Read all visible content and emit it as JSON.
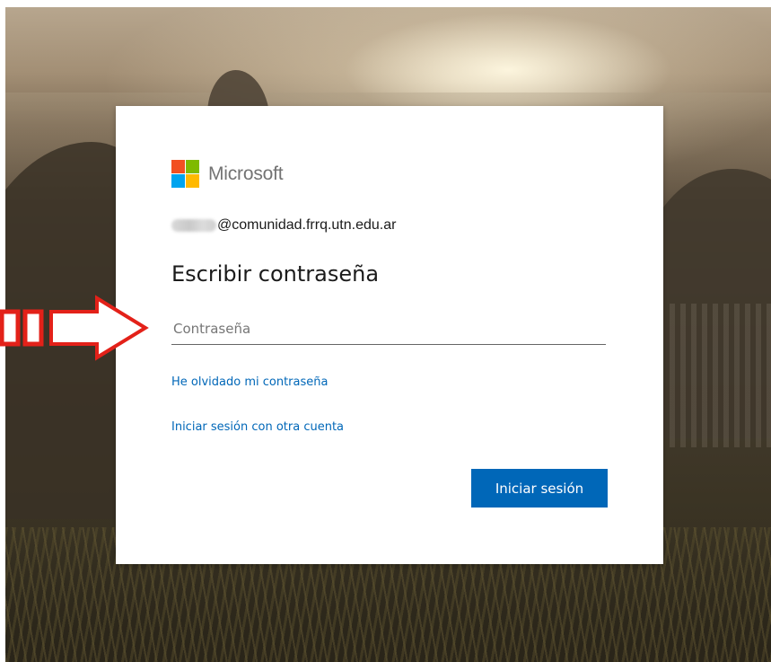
{
  "brand": {
    "name": "Microsoft",
    "logo_colors": [
      "#f25022",
      "#7fba00",
      "#00a4ef",
      "#ffb900"
    ]
  },
  "identity": {
    "email_domain": "@comunidad.frrq.utn.edu.ar"
  },
  "heading": "Escribir contraseña",
  "password": {
    "placeholder": "Contraseña",
    "value": ""
  },
  "links": {
    "forgot_password": "He olvidado mi contraseña",
    "other_account": "Iniciar sesión con otra cuenta"
  },
  "actions": {
    "sign_in_label": "Iniciar sesión"
  },
  "colors": {
    "accent": "#0067b8",
    "annotation": "#e32119"
  },
  "annotation": {
    "icon": "arrow-right-icon"
  }
}
